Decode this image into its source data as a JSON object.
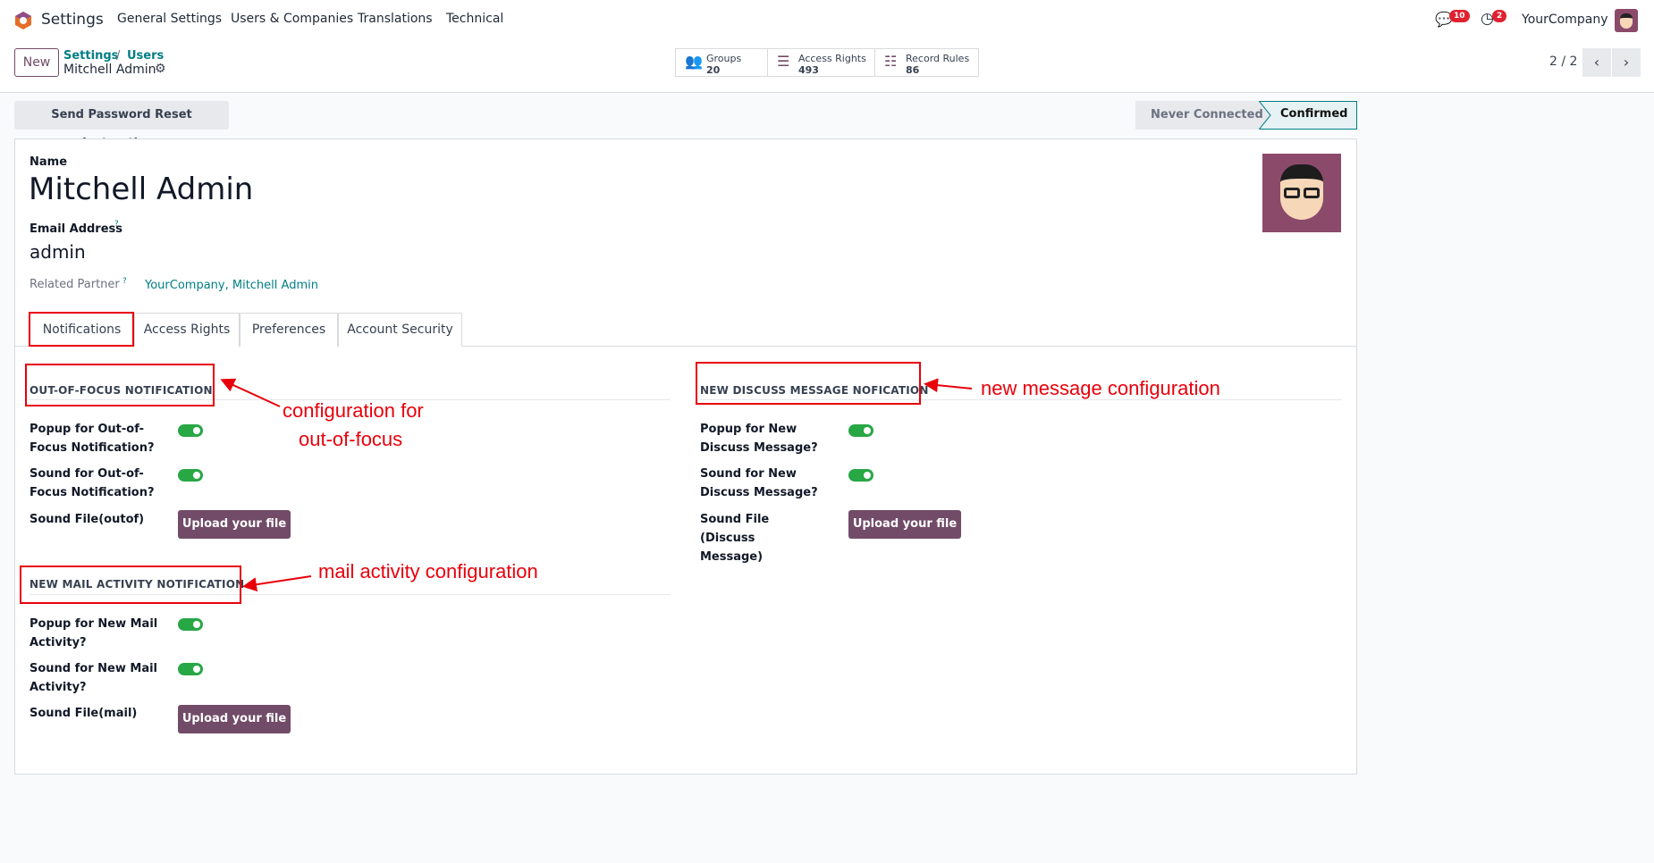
{
  "nav": {
    "app": "Settings",
    "items": [
      "General Settings",
      "Users & Companies",
      "Translations",
      "Technical"
    ],
    "messages_count": "10",
    "activities_count": "2",
    "company": "YourCompany"
  },
  "control": {
    "new_label": "New",
    "breadcrumb": [
      "Settings",
      "Users"
    ],
    "record": "Mitchell Admin",
    "stats": [
      {
        "label": "Groups",
        "value": "20",
        "icon": "users-icon"
      },
      {
        "label": "Access Rights",
        "value": "493",
        "icon": "list-icon"
      },
      {
        "label": "Record Rules",
        "value": "86",
        "icon": "list-bullet-icon"
      }
    ],
    "pager": "2 / 2"
  },
  "actions": {
    "reset_password": "Send Password Reset Instructions",
    "status": [
      "Never Connected",
      "Confirmed"
    ],
    "active_status": "Confirmed"
  },
  "form": {
    "name_label": "Name",
    "name": "Mitchell Admin",
    "email_label": "Email Address",
    "email": "admin",
    "partner_label": "Related Partner",
    "partner": "YourCompany, Mitchell Admin",
    "help": "?"
  },
  "tabs": [
    "Notifications",
    "Access Rights",
    "Preferences",
    "Account Security"
  ],
  "sections": {
    "out_of_focus": {
      "title": "OUT-OF-FOCUS NOTIFICATION",
      "popup": "Popup for Out-of-Focus Notification?",
      "sound": "Sound for Out-of-Focus Notification?",
      "file": "Sound File(outof)",
      "popup_on": true,
      "sound_on": true
    },
    "mail": {
      "title": "NEW MAIL ACTIVITY NOTIFICATION",
      "popup": "Popup for New Mail Activity?",
      "sound": "Sound for New Mail Activity?",
      "file": "Sound File(mail)",
      "popup_on": true,
      "sound_on": true
    },
    "discuss": {
      "title": "NEW DISCUSS MESSAGE NOFICATION",
      "popup": "Popup for New Discuss Message?",
      "sound": "Sound for New Discuss Message?",
      "file": "Sound File (Discuss Message)",
      "popup_on": true,
      "sound_on": true
    },
    "upload_label": "Upload your file"
  },
  "annotations": {
    "focus1": "configuration for",
    "focus2": "out-of-focus",
    "mail": "mail activity configuration",
    "discuss": "new message configuration"
  },
  "colors": {
    "brand": "#714b67",
    "toggle": "#28a745",
    "annotation": "#e8000b",
    "link": "#017e84"
  }
}
